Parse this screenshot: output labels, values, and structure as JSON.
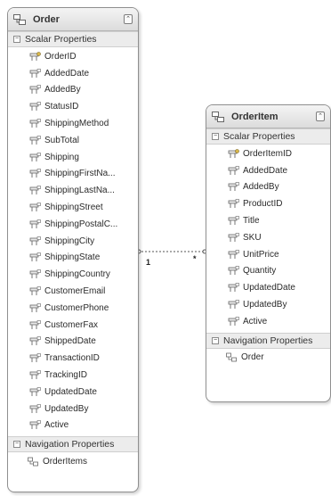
{
  "entities": {
    "order": {
      "title": "Order",
      "collapse_glyph": "⌃",
      "scalar_header": "Scalar Properties",
      "properties": [
        {
          "name": "OrderID",
          "key": true
        },
        {
          "name": "AddedDate"
        },
        {
          "name": "AddedBy"
        },
        {
          "name": "StatusID"
        },
        {
          "name": "ShippingMethod"
        },
        {
          "name": "SubTotal"
        },
        {
          "name": "Shipping"
        },
        {
          "name": "ShippingFirstNa..."
        },
        {
          "name": "ShippingLastNa..."
        },
        {
          "name": "ShippingStreet"
        },
        {
          "name": "ShippingPostalC..."
        },
        {
          "name": "ShippingCity"
        },
        {
          "name": "ShippingState"
        },
        {
          "name": "ShippingCountry"
        },
        {
          "name": "CustomerEmail"
        },
        {
          "name": "CustomerPhone"
        },
        {
          "name": "CustomerFax"
        },
        {
          "name": "ShippedDate"
        },
        {
          "name": "TransactionID"
        },
        {
          "name": "TrackingID"
        },
        {
          "name": "UpdatedDate"
        },
        {
          "name": "UpdatedBy"
        },
        {
          "name": "Active"
        }
      ],
      "navigation_header": "Navigation Properties",
      "navigation": [
        "OrderItems"
      ]
    },
    "orderitem": {
      "title": "OrderItem",
      "collapse_glyph": "⌃",
      "scalar_header": "Scalar Properties",
      "properties": [
        {
          "name": "OrderItemID",
          "key": true
        },
        {
          "name": "AddedDate"
        },
        {
          "name": "AddedBy"
        },
        {
          "name": "ProductID"
        },
        {
          "name": "Title"
        },
        {
          "name": "SKU"
        },
        {
          "name": "UnitPrice"
        },
        {
          "name": "Quantity"
        },
        {
          "name": "UpdatedDate"
        },
        {
          "name": "UpdatedBy"
        },
        {
          "name": "Active"
        }
      ],
      "navigation_header": "Navigation Properties",
      "navigation": [
        "Order"
      ]
    }
  },
  "association": {
    "from_multiplicity": "1",
    "to_multiplicity": "*"
  },
  "colors": {
    "border": "#8f8f8f",
    "header_bg": "#dcdcdc",
    "connector": "#555555"
  },
  "icons": {
    "entity": "entity-icon",
    "key_property": "key-property-icon",
    "property": "property-icon",
    "navigation": "navigation-property-icon"
  }
}
